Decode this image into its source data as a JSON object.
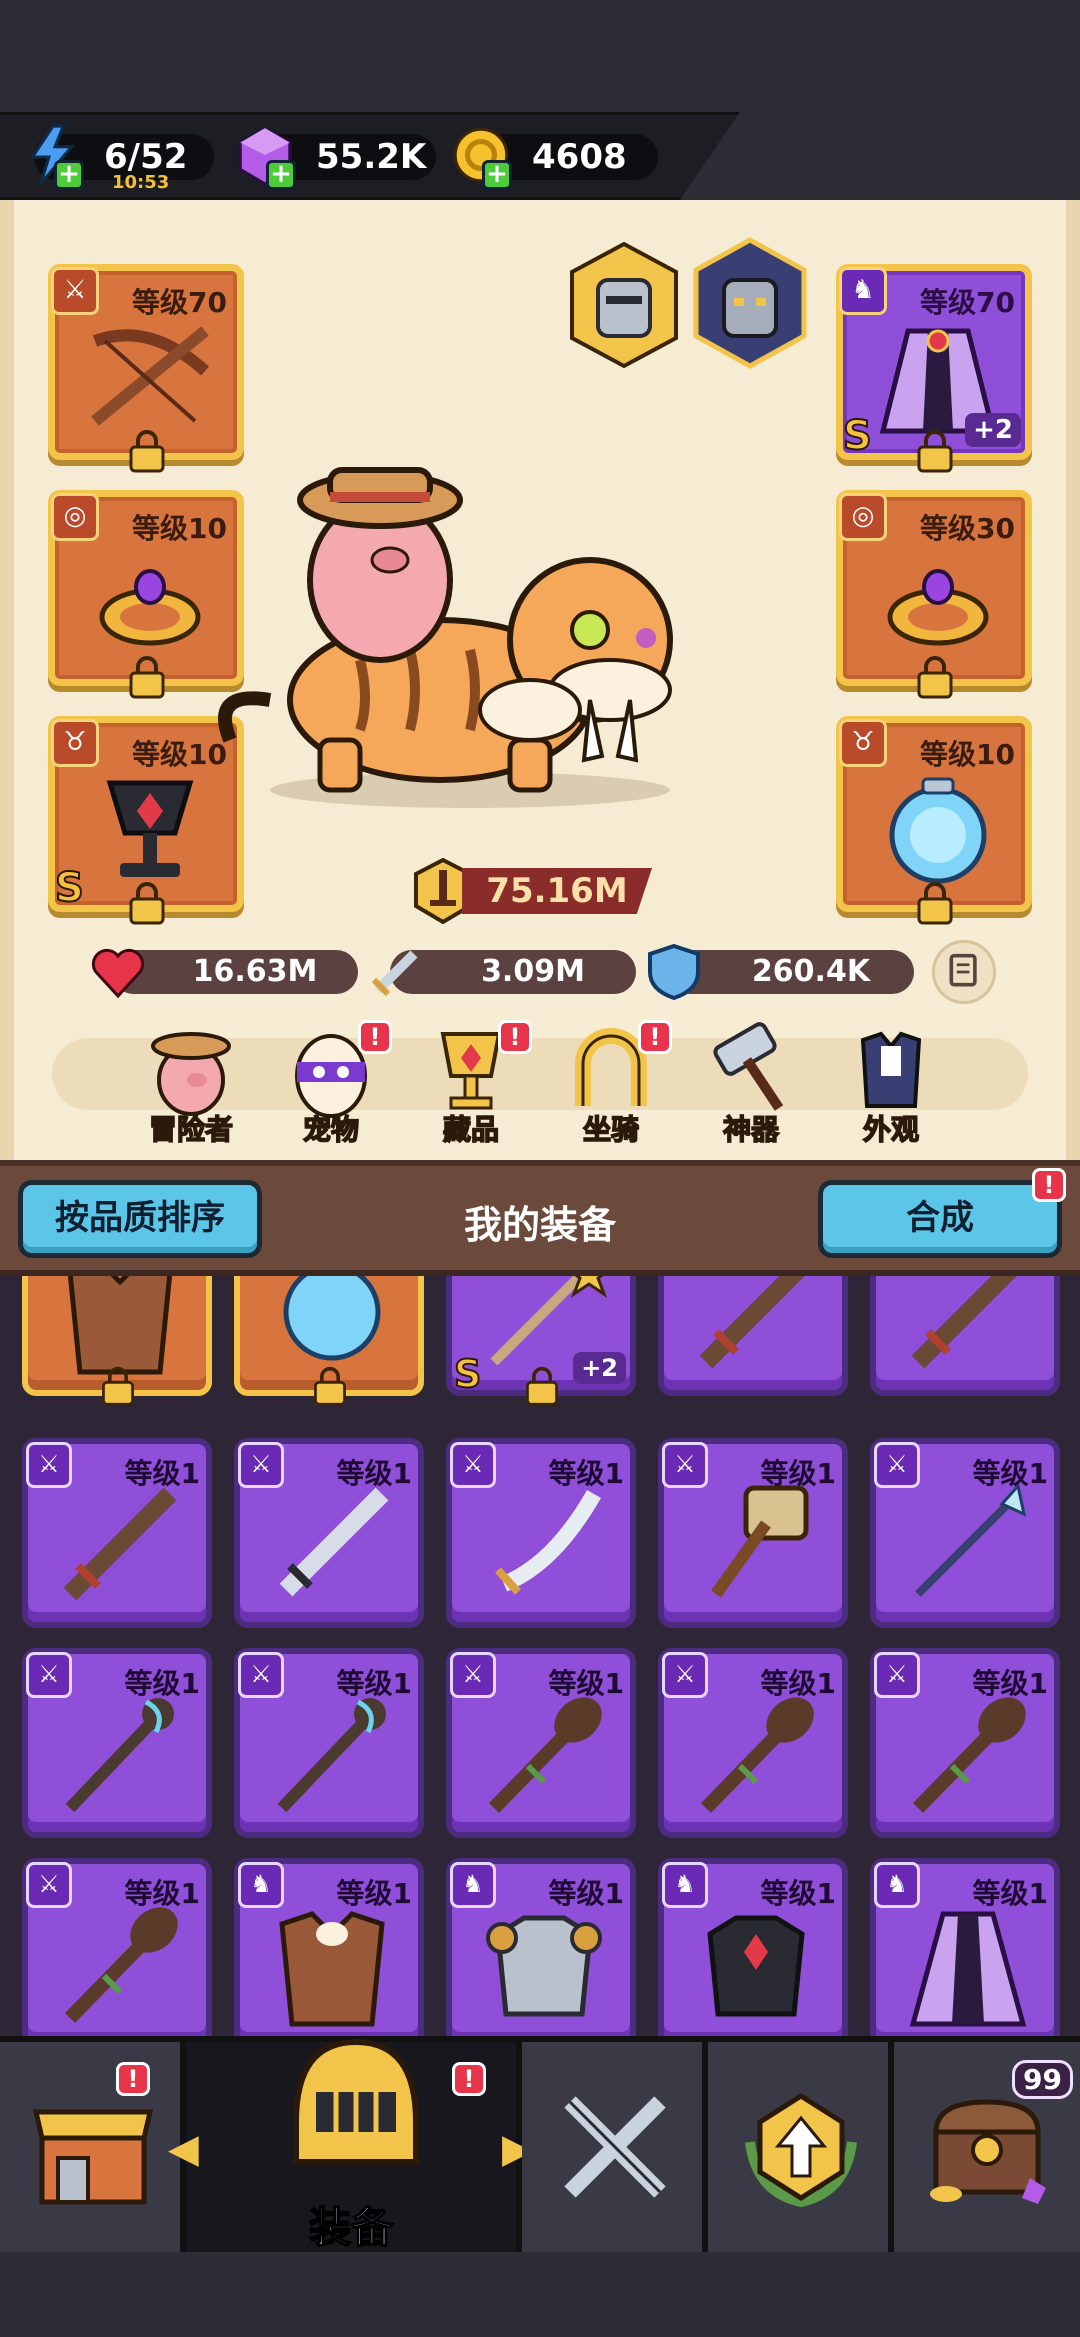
{
  "resources": {
    "energy": "6/52",
    "energy_timer": "10:53",
    "gems": "55.2K",
    "gold": "4608"
  },
  "equipped": {
    "left": [
      {
        "level": "等级70",
        "kind": "weapon",
        "grade": "",
        "plus": ""
      },
      {
        "level": "等级10",
        "kind": "ring",
        "grade": "",
        "plus": ""
      },
      {
        "level": "等级10",
        "kind": "amulet",
        "grade": "S",
        "plus": ""
      }
    ],
    "right": [
      {
        "level": "等级70",
        "kind": "armor",
        "grade": "S",
        "plus": "+2"
      },
      {
        "level": "等级30",
        "kind": "ring",
        "grade": "",
        "plus": ""
      },
      {
        "level": "等级10",
        "kind": "amulet",
        "grade": "",
        "plus": ""
      }
    ]
  },
  "power": "75.16M",
  "stats": {
    "hp": "16.63M",
    "attack": "3.09M",
    "defense": "260.4K"
  },
  "char_tabs": [
    {
      "label": "冒险者",
      "alert": ""
    },
    {
      "label": "宠物",
      "alert": "!"
    },
    {
      "label": "藏品",
      "alert": "!"
    },
    {
      "label": "坐骑",
      "alert": "!"
    },
    {
      "label": "神器",
      "alert": ""
    },
    {
      "label": "外观",
      "alert": ""
    }
  ],
  "equipment_header": {
    "sort_button": "按品质排序",
    "title": "我的装备",
    "merge_button": "合成",
    "merge_alert": "!"
  },
  "inventory_top_row": [
    {
      "kind": "armor-brown",
      "style": "gold",
      "grade": "",
      "plus": ""
    },
    {
      "kind": "amulet",
      "style": "gold",
      "grade": "",
      "plus": ""
    },
    {
      "kind": "staff-star",
      "style": "purple",
      "grade": "S",
      "plus": "+2"
    },
    {
      "kind": "sword-wood",
      "style": "purple",
      "grade": "",
      "plus": ""
    },
    {
      "kind": "sword-wood",
      "style": "purple",
      "grade": "",
      "plus": ""
    }
  ],
  "inventory": [
    {
      "level": "等级1",
      "kind": "sword-wood"
    },
    {
      "level": "等级1",
      "kind": "sword-steel"
    },
    {
      "level": "等级1",
      "kind": "saber"
    },
    {
      "level": "等级1",
      "kind": "hammer"
    },
    {
      "level": "等级1",
      "kind": "spear"
    },
    {
      "level": "等级1",
      "kind": "staff-blue"
    },
    {
      "level": "等级1",
      "kind": "staff-blue"
    },
    {
      "level": "等级1",
      "kind": "club"
    },
    {
      "level": "等级1",
      "kind": "club"
    },
    {
      "level": "等级1",
      "kind": "club"
    },
    {
      "level": "等级1",
      "kind": "club"
    },
    {
      "level": "等级1",
      "kind": "armor-brown"
    },
    {
      "level": "等级1",
      "kind": "armor-steel"
    },
    {
      "level": "等级1",
      "kind": "armor-dark"
    },
    {
      "level": "等级1",
      "kind": "robe"
    }
  ],
  "bottom_nav": {
    "shop_alert": "!",
    "equip_label": "装备",
    "equip_alert": "!",
    "chest_count": "99"
  }
}
